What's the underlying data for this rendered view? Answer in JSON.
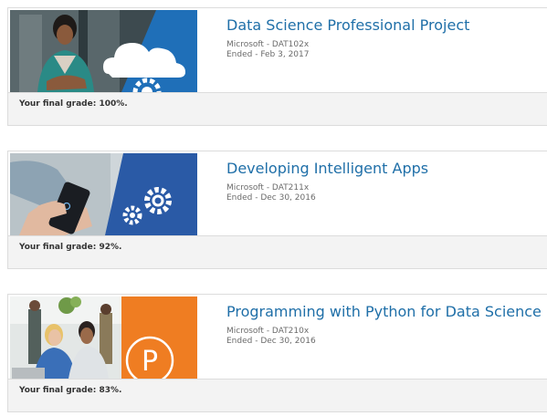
{
  "courses": [
    {
      "title": "Data Science Professional Project",
      "provider": "Microsoft - DAT102x",
      "ended": "Ended - Feb 3, 2017",
      "grade_text": "Your final grade: 100%.",
      "grade_percent": 100,
      "thumbnail_icon": "cloud-gear-icon",
      "accent_color": "#1f6fb8"
    },
    {
      "title": "Developing Intelligent Apps",
      "provider": "Microsoft - DAT211x",
      "ended": "Ended - Dec 30, 2016",
      "grade_text": "Your final grade: 92%.",
      "grade_percent": 92,
      "thumbnail_icon": "gears-icon",
      "accent_color": "#2a5aa6"
    },
    {
      "title": "Programming with Python for Data Science",
      "provider": "Microsoft - DAT210x",
      "ended": "Ended - Dec 30, 2016",
      "grade_text": "Your final grade: 83%.",
      "grade_percent": 83,
      "thumbnail_icon": "python-p-icon",
      "accent_color": "#ef7d22"
    }
  ]
}
